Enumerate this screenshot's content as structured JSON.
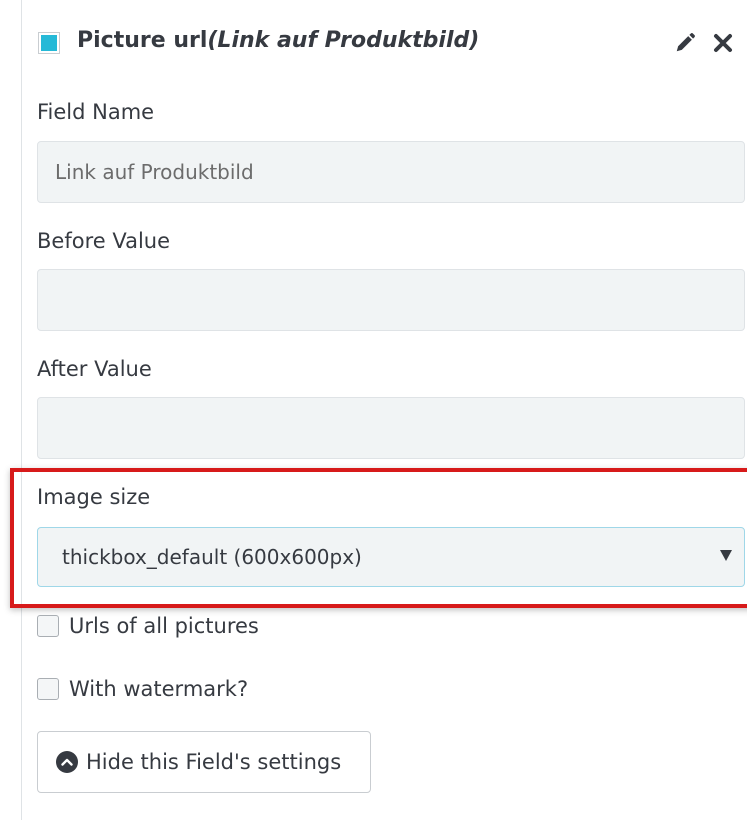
{
  "header": {
    "title_main": "Picture url",
    "title_sub": "(Link auf Produktbild)",
    "color": "#25b9d7",
    "icons": [
      "pencil-icon",
      "close-icon"
    ]
  },
  "fields": {
    "field_name": {
      "label": "Field Name",
      "value": "Link auf Produktbild"
    },
    "before_value": {
      "label": "Before Value",
      "value": ""
    },
    "after_value": {
      "label": "After Value",
      "value": ""
    }
  },
  "image_size": {
    "label": "Image size",
    "selected": "thickbox_default (600x600px)"
  },
  "options": {
    "urls_all_pictures": {
      "label": "Urls of all pictures",
      "checked": false
    },
    "with_watermark": {
      "label": "With watermark?",
      "checked": false
    }
  },
  "actions": {
    "hide_settings_label": "Hide this Field's settings"
  },
  "colors": {
    "highlight": "#d71a1a",
    "field_bg": "#f1f4f5"
  }
}
